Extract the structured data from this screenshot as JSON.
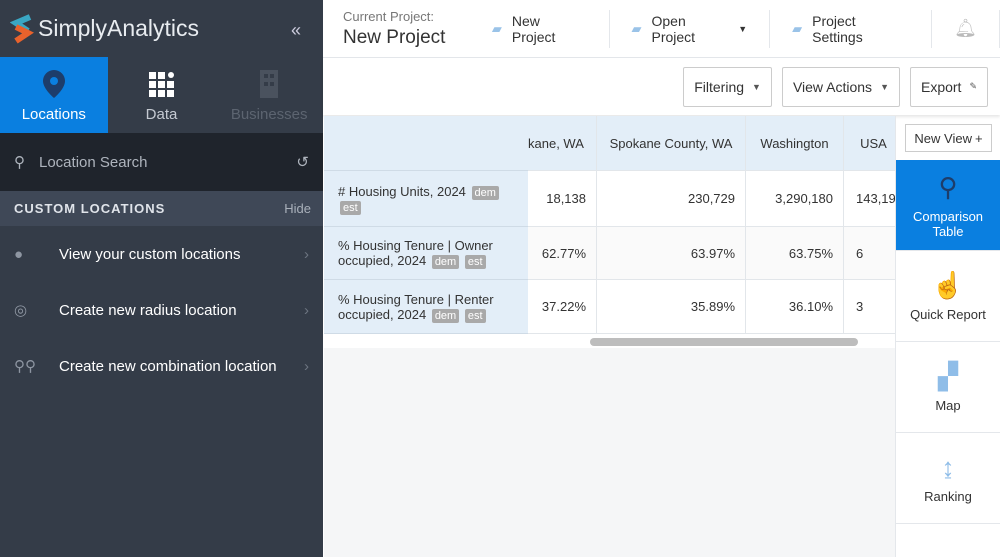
{
  "app": {
    "name": "SimplyAnalytics",
    "collapse_icon": "double-chevron-left"
  },
  "sidebar": {
    "tabs": [
      {
        "label": "Locations",
        "icon": "map-pin",
        "active": true
      },
      {
        "label": "Data",
        "icon": "grid"
      },
      {
        "label": "Businesses",
        "icon": "building",
        "disabled": true
      }
    ],
    "search_placeholder": "Location Search",
    "custom_header": "CUSTOM LOCATIONS",
    "hide_label": "Hide",
    "items": [
      {
        "label": "View your custom locations",
        "icon": "person"
      },
      {
        "label": "Create new radius location",
        "icon": "radius-pin"
      },
      {
        "label": "Create new combination location",
        "icon": "combination-pin"
      }
    ]
  },
  "header": {
    "current_project_label": "Current Project:",
    "project_name": "New Project",
    "new_project": "New Project",
    "open_project": "Open Project",
    "project_settings": "Project Settings"
  },
  "toolbar": {
    "filtering": "Filtering",
    "view_actions": "View Actions",
    "export": "Export"
  },
  "table": {
    "columns": [
      "kane, WA",
      "Spokane County, WA",
      "Washington",
      "USA"
    ],
    "rows": [
      {
        "label": "# Housing Units, 2024",
        "tags": [
          "dem",
          "est"
        ],
        "values": [
          "18,138",
          "230,729",
          "3,290,180",
          "143,19"
        ]
      },
      {
        "label": "% Housing Tenure | Owner occupied, 2024",
        "tags": [
          "dem",
          "est"
        ],
        "values": [
          "62.77%",
          "63.97%",
          "63.75%",
          "6"
        ]
      },
      {
        "label": "% Housing Tenure | Renter occupied, 2024",
        "tags": [
          "dem",
          "est"
        ],
        "values": [
          "37.22%",
          "35.89%",
          "36.10%",
          "3"
        ]
      }
    ]
  },
  "views": {
    "new_view": "New View",
    "items": [
      {
        "label": "Comparison Table",
        "active": true
      },
      {
        "label": "Quick Report"
      },
      {
        "label": "Map"
      },
      {
        "label": "Ranking"
      }
    ]
  },
  "colors": {
    "accent": "#0a7fe0",
    "sidebar": "#343c48"
  }
}
